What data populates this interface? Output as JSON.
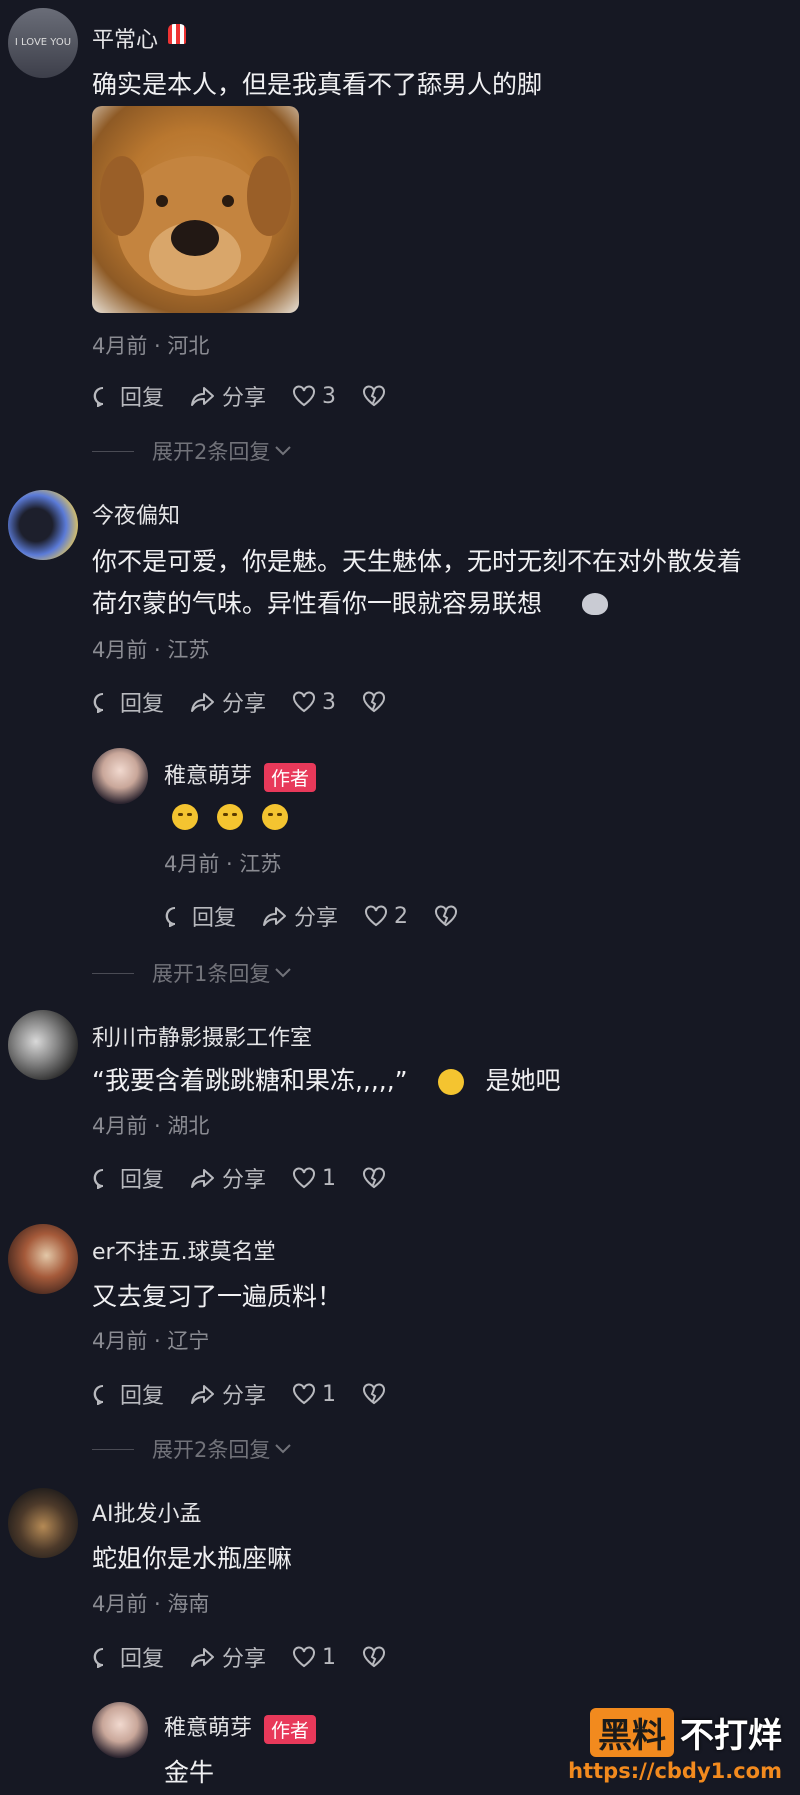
{
  "actions": {
    "reply": "回复",
    "share": "分享"
  },
  "comments": [
    {
      "username": "平常心",
      "avatar_text": "I LOVE YOU",
      "text": "确实是本人，但是我真看不了舔男人的脚",
      "meta": "4月前 · 河北",
      "likes": "3",
      "expand": "展开2条回复"
    },
    {
      "username": "今夜偏知",
      "text1": "你不是可爱，你是魅。天生魅体，无时无刻不在对外散发着",
      "text2": "荷尔蒙的气味。异性看你一眼就容易联想",
      "meta": "4月前 · 江苏",
      "likes": "3"
    },
    {
      "username": "稚意萌芽",
      "badge": "作者",
      "meta": "4月前 · 江苏",
      "likes": "2",
      "expand": "展开1条回复"
    },
    {
      "username": "利川市静影摄影工作室",
      "text": "“我要含着跳跳糖和果冻,,,,,”",
      "text_suffix": "是她吧",
      "meta": "4月前 · 湖北",
      "likes": "1"
    },
    {
      "username": "er不挂五.球莫名堂",
      "text": "又去复习了一遍质料！",
      "meta": "4月前 · 辽宁",
      "likes": "1",
      "expand": "展开2条回复"
    },
    {
      "username": "AI批发小孟",
      "text": "蛇姐你是水瓶座嘛",
      "meta": "4月前 · 海南",
      "likes": "1"
    },
    {
      "username": "稚意萌芽",
      "badge": "作者",
      "text": "金牛"
    }
  ],
  "watermark": {
    "box": "黑料",
    "text": "不打烊",
    "url": "https://cbdy1.com"
  }
}
